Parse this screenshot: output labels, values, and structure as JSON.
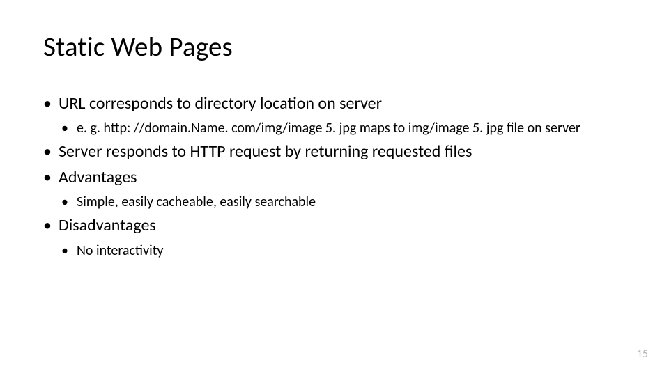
{
  "title": "Static Web Pages",
  "bullets": {
    "b0": "URL corresponds to directory location on server",
    "b0_0": "e. g. http: //domain.Name. com/img/image 5. jpg maps to img/image 5. jpg file on server",
    "b1": "Server responds to HTTP request by returning requested files",
    "b2": "Advantages",
    "b2_0": "Simple, easily cacheable, easily searchable",
    "b3": "Disadvantages",
    "b3_0": "No interactivity"
  },
  "page_number": "15"
}
